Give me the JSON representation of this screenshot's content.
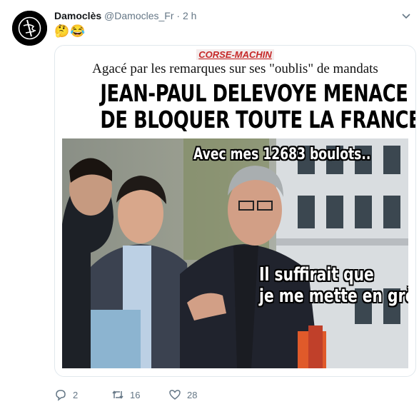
{
  "tweet": {
    "author": {
      "name": "Damoclès",
      "handle": "@Damocles_Fr",
      "separator": "·",
      "time": "2 h",
      "avatar_icon": "damocles-sword-logo"
    },
    "text_emojis": [
      "🤔",
      "😂"
    ],
    "meme": {
      "source_label": "CORSE-MACHIN",
      "subtitle": "Agacé par les remarques sur ses \"oublis\" de mandats",
      "headline_line1": "JEAN-PAUL DELEVOYE MENACE",
      "headline_line2": "DE BLOQUER TOUTE LA FRANCE",
      "caption_top": "Avec mes 12683 boulots..",
      "caption_bottom_line1": "Il suffirait que",
      "caption_bottom_line2": "je me mette en grève",
      "colors": {
        "source_label": "#c62828",
        "caption_text": "#ffffff",
        "caption_outline": "#000000"
      }
    },
    "actions": {
      "reply": {
        "icon": "reply-icon",
        "count": "2"
      },
      "retweet": {
        "icon": "retweet-icon",
        "count": "16"
      },
      "like": {
        "icon": "heart-icon",
        "count": "28"
      }
    },
    "menu_icon": "chevron-down-icon"
  },
  "colors": {
    "text_primary": "#14171a",
    "text_secondary": "#657786",
    "border": "#e1e8ed"
  }
}
